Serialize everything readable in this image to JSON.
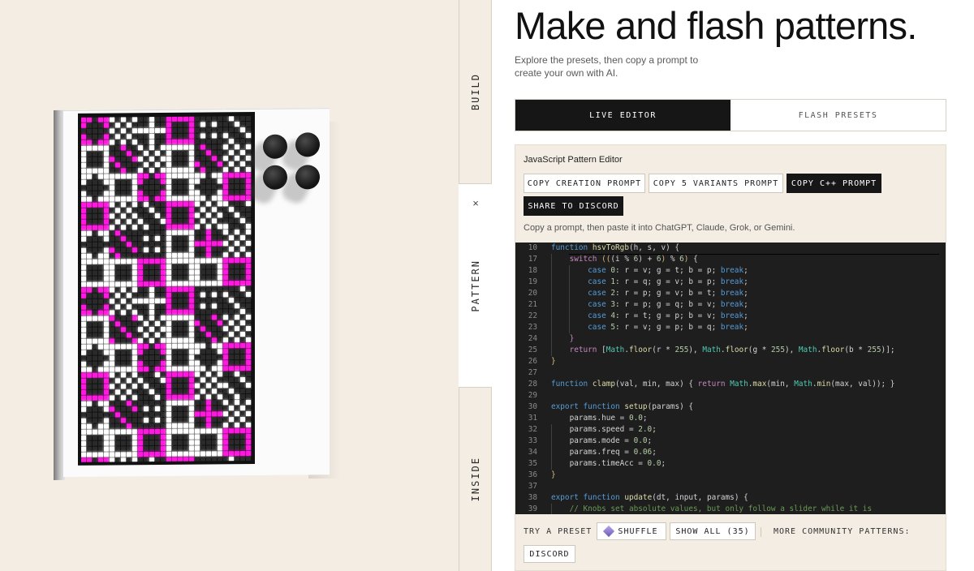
{
  "header": {
    "title": "Make and flash patterns.",
    "subtitle": "Explore the presets, then copy a prompt to create your own with AI."
  },
  "side_tabs": [
    {
      "label": "BUILD"
    },
    {
      "label": "PATTERN",
      "active": true
    },
    {
      "label": "INSIDE"
    }
  ],
  "close_glyph": "×",
  "mode_tabs": [
    {
      "label": "LIVE EDITOR",
      "active": true
    },
    {
      "label": "FLASH PRESETS",
      "active": false
    }
  ],
  "editor": {
    "title": "JavaScript Pattern Editor",
    "buttons": {
      "copy_creation": "COPY CREATION PROMPT",
      "copy_variants": "COPY 5 VARIANTS PROMPT",
      "copy_cpp": "COPY C++ PROMPT",
      "share_discord": "SHARE TO DISCORD"
    },
    "hint": "Copy a prompt, then paste it into ChatGPT, Claude, Grok, or Gemini.",
    "code_lines": [
      {
        "n": "10",
        "html": "<span class='kw'>function</span> <span class='fn'>hsvToRgb</span>(h, s, v) {"
      },
      {
        "n": "17",
        "html": "    <span class='cf'>switch</span> <span class='br'>((</span>(i % <span class='nm'>6</span>) + <span class='nm'>6</span><span class='br'>)</span> % <span class='nm'>6</span><span class='br'>)</span> {"
      },
      {
        "n": "18",
        "html": "        <span class='kw'>case</span> <span class='nm'>0</span>: r = v; g = t; b = p; <span class='kw'>break</span>;"
      },
      {
        "n": "19",
        "html": "        <span class='kw'>case</span> <span class='nm'>1</span>: r = q; g = v; b = p; <span class='kw'>break</span>;"
      },
      {
        "n": "20",
        "html": "        <span class='kw'>case</span> <span class='nm'>2</span>: r = p; g = v; b = t; <span class='kw'>break</span>;"
      },
      {
        "n": "21",
        "html": "        <span class='kw'>case</span> <span class='nm'>3</span>: r = p; g = q; b = v; <span class='kw'>break</span>;"
      },
      {
        "n": "22",
        "html": "        <span class='kw'>case</span> <span class='nm'>4</span>: r = t; g = p; b = v; <span class='kw'>break</span>;"
      },
      {
        "n": "23",
        "html": "        <span class='kw'>case</span> <span class='nm'>5</span>: r = v; g = p; b = q; <span class='kw'>break</span>;"
      },
      {
        "n": "24",
        "html": "    <span class='cf'>}</span>"
      },
      {
        "n": "25",
        "html": "    <span class='cf'>return</span> [<span class='ty'>Math</span>.<span class='fn'>floor</span>(r * <span class='nm'>255</span>), <span class='ty'>Math</span>.<span class='fn'>floor</span>(g * <span class='nm'>255</span>), <span class='ty'>Math</span>.<span class='fn'>floor</span>(b * <span class='nm'>255</span>)];"
      },
      {
        "n": "26",
        "html": "<span class='br'>}</span>"
      },
      {
        "n": "27",
        "html": ""
      },
      {
        "n": "28",
        "html": "<span class='kw'>function</span> <span class='fn'>clamp</span>(val, min, max) { <span class='cf'>return</span> <span class='ty'>Math</span>.<span class='fn'>max</span>(min, <span class='ty'>Math</span>.<span class='fn'>min</span>(max, val)); }"
      },
      {
        "n": "29",
        "html": ""
      },
      {
        "n": "30",
        "html": "<span class='kw'>export</span> <span class='kw'>function</span> <span class='fn'>setup</span>(params) {"
      },
      {
        "n": "31",
        "html": "    params.hue = <span class='nm'>0.0</span>;"
      },
      {
        "n": "32",
        "html": "    params.speed = <span class='nm'>2.0</span>;"
      },
      {
        "n": "33",
        "html": "    params.mode = <span class='nm'>0.0</span>;"
      },
      {
        "n": "34",
        "html": "    params.freq = <span class='nm'>0.06</span>;"
      },
      {
        "n": "35",
        "html": "    params.timeAcc = <span class='nm'>0.0</span>;"
      },
      {
        "n": "36",
        "html": "<span class='br'>}</span>"
      },
      {
        "n": "37",
        "html": ""
      },
      {
        "n": "38",
        "html": "<span class='kw'>export</span> <span class='kw'>function</span> <span class='fn'>update</span>(dt, input, params) {"
      },
      {
        "n": "39",
        "html": "    <span class='cm'>// Knobs set absolute values, but only follow a slider while it is</span>"
      }
    ]
  },
  "bottom": {
    "try_label": "TRY A PRESET",
    "shuffle": "SHUFFLE",
    "show_all": "SHOW ALL (35)",
    "community_label": "MORE COMMUNITY PATTERNS:",
    "discord": "DISCORD"
  },
  "device": {
    "colors": {
      "magenta": "#ff19e0",
      "white": "#ffffff",
      "dark": "#2a2a2a"
    },
    "knobs": 4
  }
}
